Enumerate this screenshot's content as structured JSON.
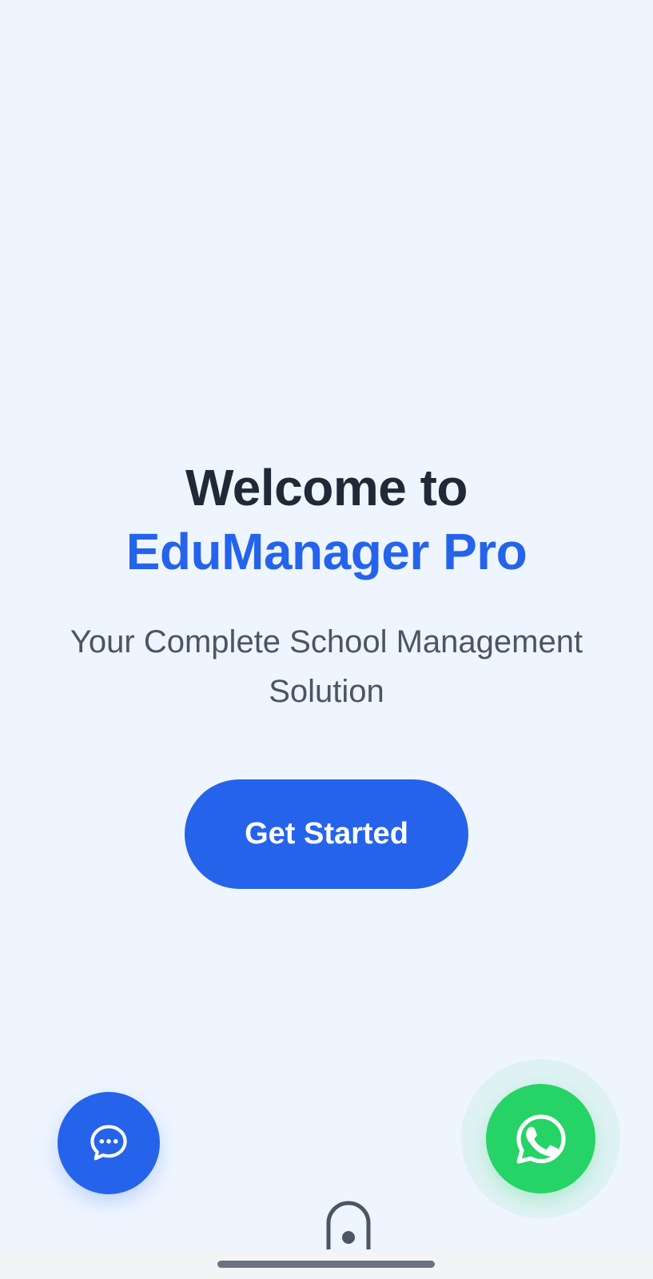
{
  "hero": {
    "welcome_text": "Welcome to",
    "brand_name": "EduManager Pro",
    "subtitle": "Your Complete School Management Solution"
  },
  "cta": {
    "label": "Get Started"
  },
  "fabs": {
    "chat_icon": "chat-bubble-icon",
    "whatsapp_icon": "whatsapp-icon"
  },
  "colors": {
    "background": "#eef5ff",
    "heading": "#1f2937",
    "brand": "#2563eb",
    "subtitle": "#4b5563",
    "button": "#2563eb",
    "whatsapp": "#25d366"
  }
}
